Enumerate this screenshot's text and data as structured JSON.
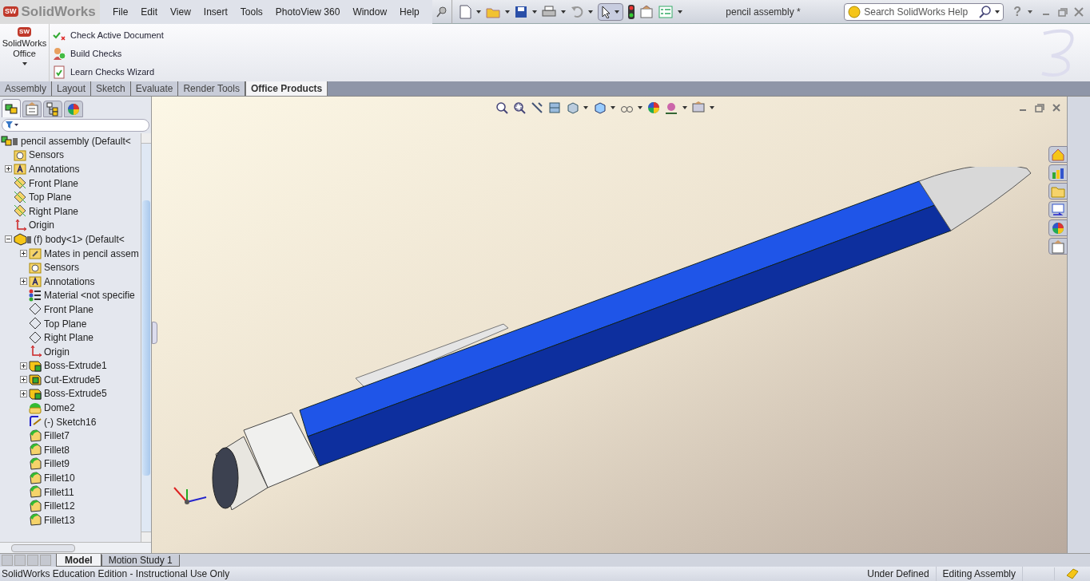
{
  "app": {
    "logo_badge": "SW",
    "logo_text": "SolidWorks",
    "menu": [
      "File",
      "Edit",
      "View",
      "Insert",
      "Tools",
      "PhotoView 360",
      "Window",
      "Help"
    ],
    "document_title": "pencil assembly *",
    "search": {
      "placeholder": "Search SolidWorks Help"
    },
    "help_mark": "?"
  },
  "ribbon": {
    "office_button": {
      "badge": "SW",
      "label": "SolidWorks Office"
    },
    "commands": [
      {
        "kind": "check",
        "label": "Check Active Document"
      },
      {
        "kind": "build",
        "label": "Build Checks"
      },
      {
        "kind": "wizard",
        "label": "Learn Checks Wizard"
      }
    ],
    "tabs": [
      {
        "label": "Assembly",
        "selected": false
      },
      {
        "label": "Layout",
        "selected": false
      },
      {
        "label": "Sketch",
        "selected": false
      },
      {
        "label": "Evaluate",
        "selected": false
      },
      {
        "label": "Render Tools",
        "selected": false
      },
      {
        "label": "Office Products",
        "selected": true
      }
    ]
  },
  "feature_manager": {
    "panel_tabs": [
      {
        "kind": "tree",
        "selected": true
      },
      {
        "kind": "property",
        "selected": false
      },
      {
        "kind": "config",
        "selected": false
      },
      {
        "kind": "appearance",
        "selected": false
      }
    ],
    "tree": [
      {
        "label": "pencil assembly  (Default<",
        "kind": "assembly",
        "children": [
          {
            "label": "Sensors",
            "kind": "sensor"
          },
          {
            "label": "Annotations",
            "kind": "annotation",
            "expanded": false
          },
          {
            "label": "Front Plane",
            "kind": "plane"
          },
          {
            "label": "Top Plane",
            "kind": "plane"
          },
          {
            "label": "Right Plane",
            "kind": "plane"
          },
          {
            "label": "Origin",
            "kind": "origin"
          },
          {
            "label": "(f) body<1> (Default<",
            "kind": "part",
            "expanded": true,
            "children": [
              {
                "label": "Mates in pencil assem",
                "kind": "mates",
                "expanded": false
              },
              {
                "label": "Sensors",
                "kind": "sensor"
              },
              {
                "label": "Annotations",
                "kind": "annotation",
                "expanded": false
              },
              {
                "label": "Material <not specifie",
                "kind": "material"
              },
              {
                "label": "Front Plane",
                "kind": "plane-outline"
              },
              {
                "label": "Top Plane",
                "kind": "plane-outline"
              },
              {
                "label": "Right Plane",
                "kind": "plane-outline"
              },
              {
                "label": "Origin",
                "kind": "origin"
              },
              {
                "label": "Boss-Extrude1",
                "kind": "boss",
                "expanded": false
              },
              {
                "label": "Cut-Extrude5",
                "kind": "cut",
                "expanded": false
              },
              {
                "label": "Boss-Extrude5",
                "kind": "boss",
                "expanded": false
              },
              {
                "label": "Dome2",
                "kind": "dome"
              },
              {
                "label": "(-) Sketch16",
                "kind": "sketch"
              },
              {
                "label": "Fillet7",
                "kind": "fillet"
              },
              {
                "label": "Fillet8",
                "kind": "fillet"
              },
              {
                "label": "Fillet9",
                "kind": "fillet"
              },
              {
                "label": "Fillet10",
                "kind": "fillet"
              },
              {
                "label": "Fillet11",
                "kind": "fillet"
              },
              {
                "label": "Fillet12",
                "kind": "fillet"
              },
              {
                "label": "Fillet13",
                "kind": "fillet"
              }
            ]
          }
        ]
      }
    ]
  },
  "bottom_tabs": [
    {
      "label": "Model",
      "selected": true
    },
    {
      "label": "Motion Study 1",
      "selected": false
    }
  ],
  "status_bar": {
    "message": "SolidWorks Education Edition - Instructional Use Only",
    "sections": [
      "Under Defined",
      "Editing Assembly"
    ]
  }
}
